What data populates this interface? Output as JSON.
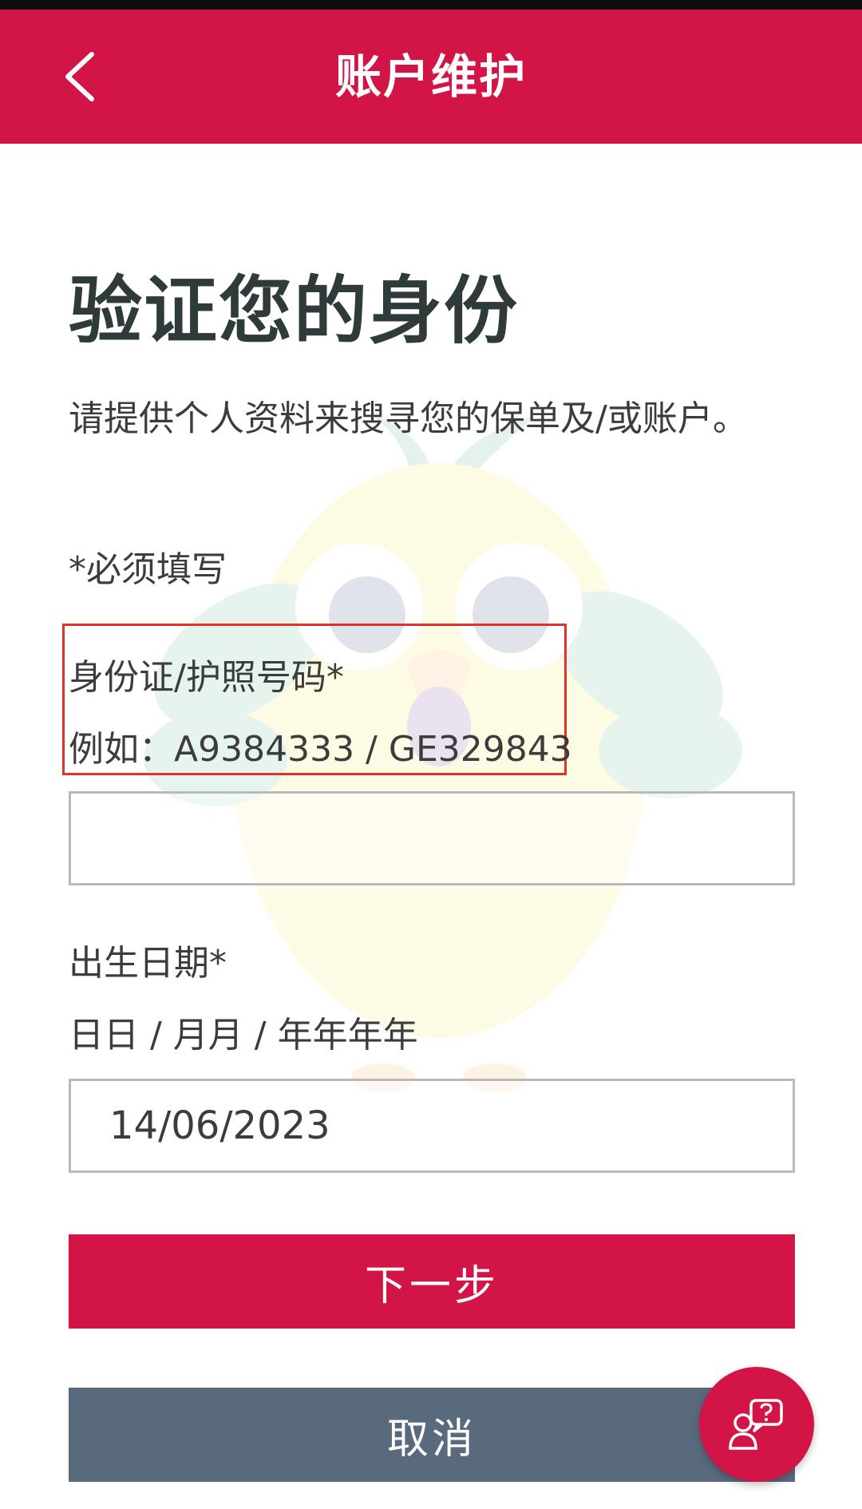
{
  "header": {
    "title": "账户维护",
    "back_icon": "chevron-left-icon"
  },
  "page": {
    "title": "验证您的身份",
    "description": "请提供个人资料来搜寻您的保单及/或账户。",
    "required_note": "*必须填写"
  },
  "id_field": {
    "label": "身份证/护照号码*",
    "hint": "例如：A9384333 / GE329843",
    "value": "",
    "placeholder": ""
  },
  "dob_field": {
    "label": "出生日期*",
    "hint": "日日 / 月月 / 年年年年",
    "value": "14/06/2023"
  },
  "buttons": {
    "next_label": "下一步",
    "cancel_label": "取消"
  },
  "fab": {
    "icon": "help-chat-icon"
  },
  "colors": {
    "brand": "#d21446",
    "cancel": "#5a6a7d",
    "highlight": "#e3312b"
  }
}
